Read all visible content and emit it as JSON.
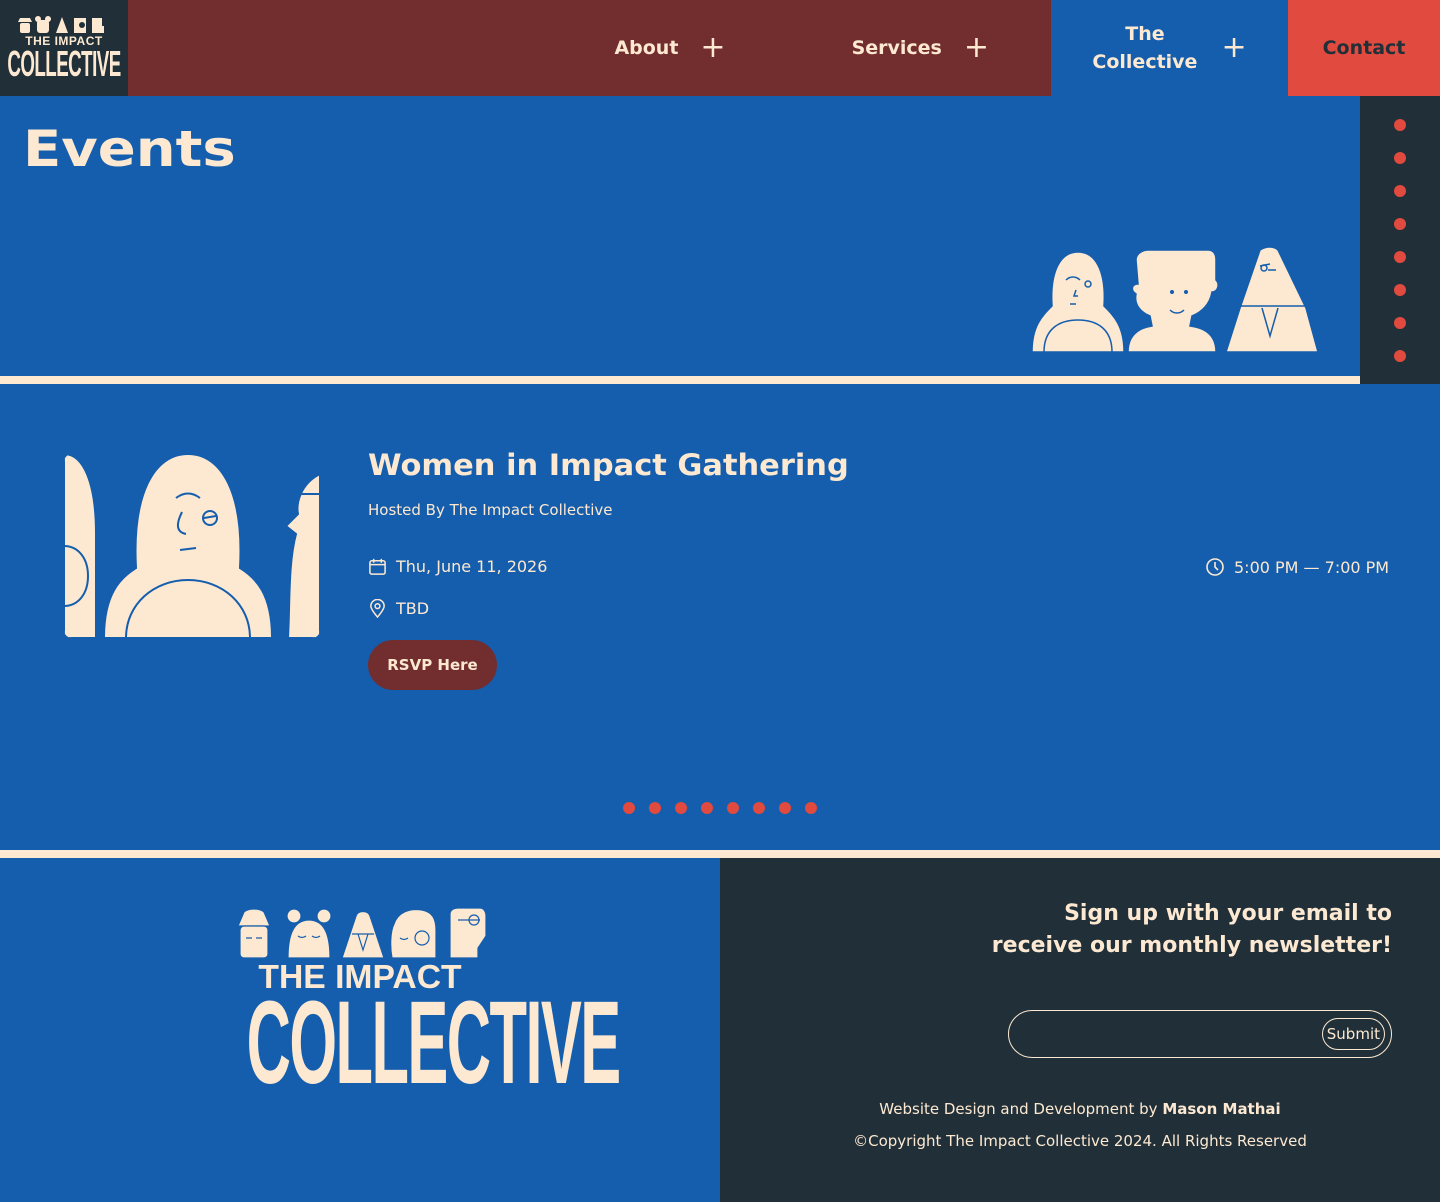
{
  "brand": {
    "logo_top": "THE IMPACT",
    "logo_bottom": "COLLECTIVE"
  },
  "nav": {
    "about": "About",
    "services": "Services",
    "collective_line1": "The",
    "collective_line2": "Collective",
    "contact": "Contact",
    "expand_glyph": "+"
  },
  "hero": {
    "title": "Events"
  },
  "event": {
    "title": "Women in Impact Gathering",
    "host": "Hosted By The Impact Collective",
    "date": "Thu, June 11, 2026",
    "time": "5:00 PM — 7:00 PM",
    "location": "TBD",
    "rsvp_label": "RSVP Here"
  },
  "pager": {
    "count": 8
  },
  "side_nav": {
    "count": 8
  },
  "footer": {
    "logo_top": "THE IMPACT",
    "logo_bottom": "COLLECTIVE",
    "newsletter_line1": "Sign up with your email to",
    "newsletter_line2": "receive our monthly newsletter!",
    "email_placeholder": "",
    "submit_label": "Submit",
    "credit_prefix": "Website Design and Development by ",
    "credit_name": "Mason Mathai",
    "copyright": "©Copyright The Impact Collective 2024. All Rights Reserved"
  },
  "colors": {
    "blue": "#155ead",
    "maroon": "#722e2f",
    "dark": "#213038",
    "red": "#e04a3f",
    "cream": "#fde9d2"
  }
}
